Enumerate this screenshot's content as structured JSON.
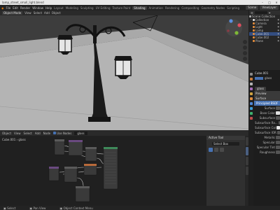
{
  "window": {
    "title": "lamp_street_small_light.blend"
  },
  "menu": {
    "items": [
      "File",
      "Edit",
      "Render",
      "Window",
      "Help"
    ]
  },
  "workspaces": {
    "tabs": [
      {
        "label": "Layout",
        "active": false
      },
      {
        "label": "Modeling",
        "active": false
      },
      {
        "label": "Sculpting",
        "active": false
      },
      {
        "label": "UV Editing",
        "active": false
      },
      {
        "label": "Texture Paint",
        "active": false
      },
      {
        "label": "Shading",
        "active": true
      },
      {
        "label": "Animation",
        "active": false
      },
      {
        "label": "Rendering",
        "active": false
      },
      {
        "label": "Compositing",
        "active": false
      },
      {
        "label": "Geometry Nodes",
        "active": false
      },
      {
        "label": "Scripting",
        "active": false
      }
    ]
  },
  "topright": {
    "scene": "Scene",
    "view_layer": "ViewLayer"
  },
  "viewport_header": {
    "mode": "Object Mode",
    "items": [
      "View",
      "Select",
      "Add",
      "Object"
    ]
  },
  "outliner": {
    "rows": [
      {
        "label": "Scene Collection",
        "selected": false
      },
      {
        "label": "Collection",
        "selected": false
      },
      {
        "label": "Camera",
        "selected": false
      },
      {
        "label": "Light",
        "selected": false
      },
      {
        "label": "Lamp",
        "selected": false
      },
      {
        "label": "Cube.001",
        "selected": true
      },
      {
        "label": "Cube.002",
        "selected": false
      },
      {
        "label": "Plane",
        "selected": false
      }
    ]
  },
  "properties": {
    "object_name": "Cube.001",
    "material_name": "glass",
    "sections": [
      {
        "type": "hdr",
        "label": "Preview"
      },
      {
        "type": "hdr",
        "label": "Surface"
      },
      {
        "type": "blue",
        "label": "Principled BSDF"
      },
      {
        "type": "field",
        "label": "Surface"
      },
      {
        "type": "field",
        "label": "Base Color"
      },
      {
        "type": "field",
        "label": "Subsurface"
      },
      {
        "type": "field",
        "label": "Subsurface Ra..."
      },
      {
        "type": "field",
        "label": "Subsurface Col"
      },
      {
        "type": "field",
        "label": "Subsurface IOR"
      },
      {
        "type": "field",
        "label": "Metallic"
      },
      {
        "type": "field",
        "label": "Specular"
      },
      {
        "type": "field",
        "label": "Specular Tint"
      },
      {
        "type": "field",
        "label": "Roughness"
      }
    ]
  },
  "node_editor": {
    "header": [
      "Object",
      "View",
      "Select",
      "Add",
      "Node"
    ],
    "use_nodes_label": "Use Nodes",
    "material_slot": "glass",
    "breadcrumb": "Cube.001  ›  glass",
    "side_panel_title": "Active Tool",
    "side_slot": "Select Box"
  },
  "statusbar": {
    "items": [
      "Select",
      "Pan View",
      "Object Context Menu"
    ]
  }
}
